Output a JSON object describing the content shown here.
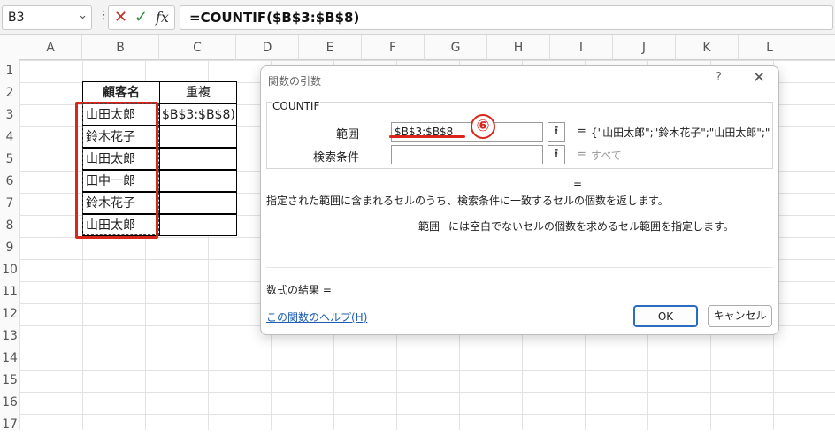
{
  "formula_bar": {
    "name_box": "B3",
    "dropdown_glyph": "⌄",
    "more_glyph": "⋮",
    "cancel_glyph": "✕",
    "enter_glyph": "✓",
    "fx_label": "fx",
    "formula": "=COUNTIF($B$3:$B$8)"
  },
  "columns": [
    "A",
    "B",
    "C",
    "D",
    "E",
    "F",
    "G",
    "H",
    "I",
    "J",
    "K",
    "L"
  ],
  "rows": [
    "1",
    "2",
    "3",
    "4",
    "5",
    "6",
    "7",
    "8",
    "9",
    "10",
    "11",
    "12",
    "13",
    "14",
    "15",
    "16",
    "17"
  ],
  "table": {
    "header_b": "顧客名",
    "header_c": "重複",
    "names": [
      "山田太郎",
      "鈴木花子",
      "山田太郎",
      "田中一郎",
      "鈴木花子",
      "山田太郎"
    ],
    "c3_formula": "$B$3:$B$8)"
  },
  "dialog": {
    "title": "関数の引数",
    "help_glyph": "?",
    "close_glyph": "✕",
    "function_name": "COUNTIF",
    "arg1_label": "範囲",
    "arg1_value": "$B$3:$B$8",
    "arg1_result": "{\"山田太郎\";\"鈴木花子\";\"山田太郎\";\"",
    "arg2_label": "検索条件",
    "arg2_value": "",
    "arg2_result": "すべて",
    "eq": "=",
    "collapse_glyph": "⭱",
    "result_eq": "=",
    "description": "指定された範囲に含まれるセルのうち、検索条件に一致するセルの個数を返します。",
    "arg_help_name": "範囲",
    "arg_help_text": "には空白でないセルの個数を求めるセル範囲を指定します。",
    "formula_result_label": "数式の結果 =",
    "help_link": "この関数のヘルプ(H)",
    "ok_label": "OK",
    "cancel_label": "キャンセル"
  },
  "annotation": {
    "number": "⑥",
    "color": "#d9261c"
  }
}
